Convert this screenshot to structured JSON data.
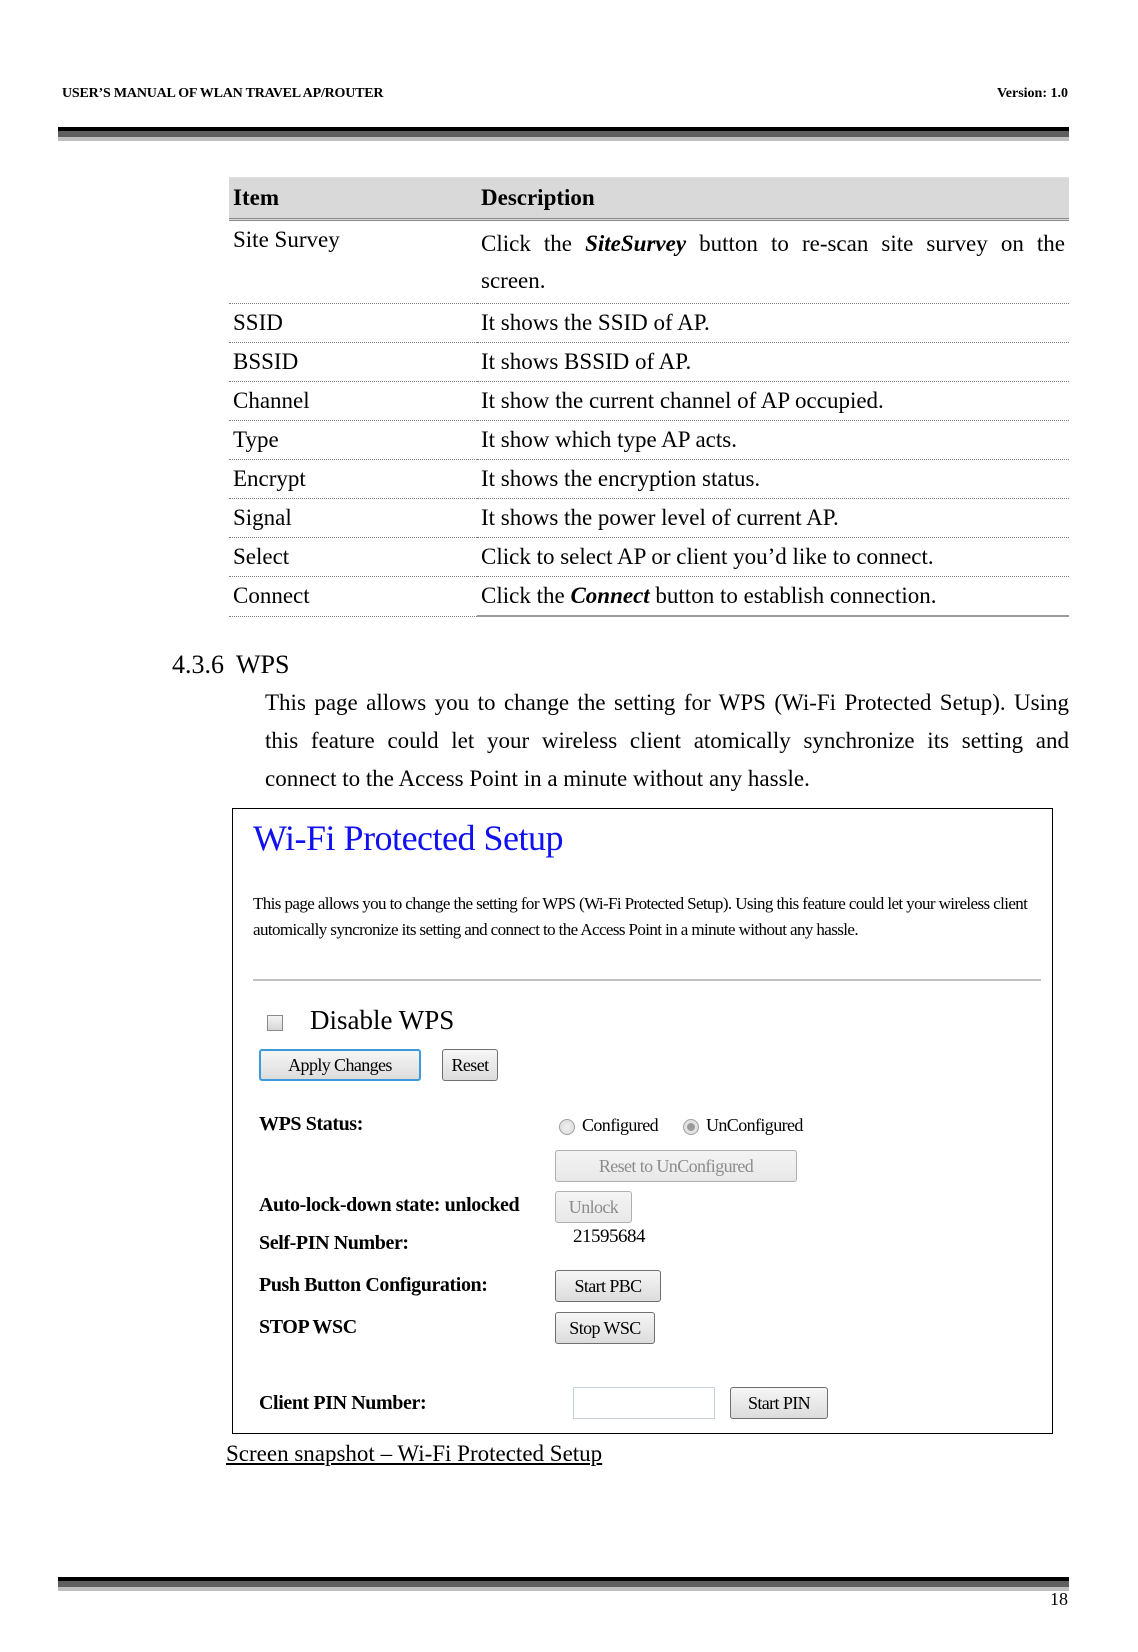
{
  "header": {
    "title": "USER’S MANUAL OF WLAN TRAVEL AP/ROUTER",
    "version": "Version: 1.0"
  },
  "table": {
    "headers": [
      "Item",
      "Description"
    ],
    "rows": [
      {
        "item": "Site Survey",
        "pre": "Click the ",
        "em": "SiteSurvey",
        "post": " button to re-scan site survey on the screen."
      },
      {
        "item": "SSID",
        "text": "It shows the SSID of AP."
      },
      {
        "item": "BSSID",
        "text": "It shows BSSID of AP."
      },
      {
        "item": "Channel",
        "text": "It show the current channel of AP occupied."
      },
      {
        "item": "Type",
        "text": "It show which type AP acts."
      },
      {
        "item": "Encrypt",
        "text": "It shows the encryption status."
      },
      {
        "item": "Signal",
        "text": "It shows the power level of current AP."
      },
      {
        "item": "Select",
        "text": "Click to select AP or client you’d like to connect."
      },
      {
        "item": "Connect",
        "pre": "Click the ",
        "em": "Connect",
        "post": " button to establish connection."
      }
    ]
  },
  "section": {
    "number": "4.3.6",
    "title": "WPS",
    "intro": "This page allows you to change the setting for WPS (Wi-Fi Protected Setup). Using this feature could let your wireless client atomically synchronize its setting and connect to the Access Point in a minute without any hassle."
  },
  "screenshot": {
    "title": "Wi-Fi Protected Setup",
    "description": "This page allows you to change the setting for WPS (Wi-Fi Protected Setup). Using this feature could let your wireless client automically syncronize its setting and connect to the Access Point in a minute without any hassle.",
    "disable_wps": {
      "label": "Disable WPS",
      "checked": false
    },
    "apply_button": "Apply Changes",
    "reset_button": "Reset",
    "wps_status": {
      "label": "WPS Status:",
      "options": [
        "Configured",
        "UnConfigured"
      ],
      "selected": "UnConfigured"
    },
    "reset_unconfigured_button": "Reset to UnConfigured",
    "auto_lock_label": "Auto-lock-down state: unlocked",
    "unlock_button": "Unlock",
    "self_pin_label": "Self-PIN Number:",
    "self_pin_value": "21595684",
    "pbc_label": "Push Button Configuration:",
    "start_pbc_button": "Start PBC",
    "stop_wsc_label": "STOP WSC",
    "stop_wsc_button": "Stop WSC",
    "client_pin_label": "Client PIN Number:",
    "client_pin_value": "",
    "start_pin_button": "Start PIN"
  },
  "caption": "Screen snapshot – Wi-Fi Protected Setup",
  "footer": {
    "page_number": "18"
  },
  "colors": {
    "title_blue": "#1010f0",
    "focus_border": "#3c9ad8",
    "header_bg": "#d9d9d9"
  }
}
